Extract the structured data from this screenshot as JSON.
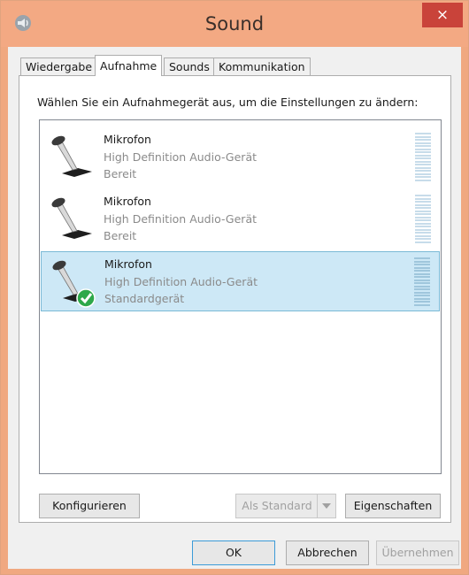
{
  "window": {
    "title": "Sound",
    "close_label": "×"
  },
  "tabs": [
    {
      "label": "Wiedergabe"
    },
    {
      "label": "Aufnahme"
    },
    {
      "label": "Sounds"
    },
    {
      "label": "Kommunikation"
    }
  ],
  "instruction": "Wählen Sie ein Aufnahmegerät aus, um die Einstellungen zu ändern:",
  "devices": [
    {
      "name": "Mikrofon",
      "description": "High Definition Audio-Gerät",
      "status": "Bereit"
    },
    {
      "name": "Mikrofon",
      "description": "High Definition Audio-Gerät",
      "status": "Bereit"
    },
    {
      "name": "Mikrofon",
      "description": "High Definition Audio-Gerät",
      "status": "Standardgerät"
    }
  ],
  "panel_buttons": {
    "configure": "Konfigurieren",
    "set_default": "Als Standard",
    "properties": "Eigenschaften"
  },
  "dialog_buttons": {
    "ok": "OK",
    "cancel": "Abbrechen",
    "apply": "Übernehmen"
  }
}
